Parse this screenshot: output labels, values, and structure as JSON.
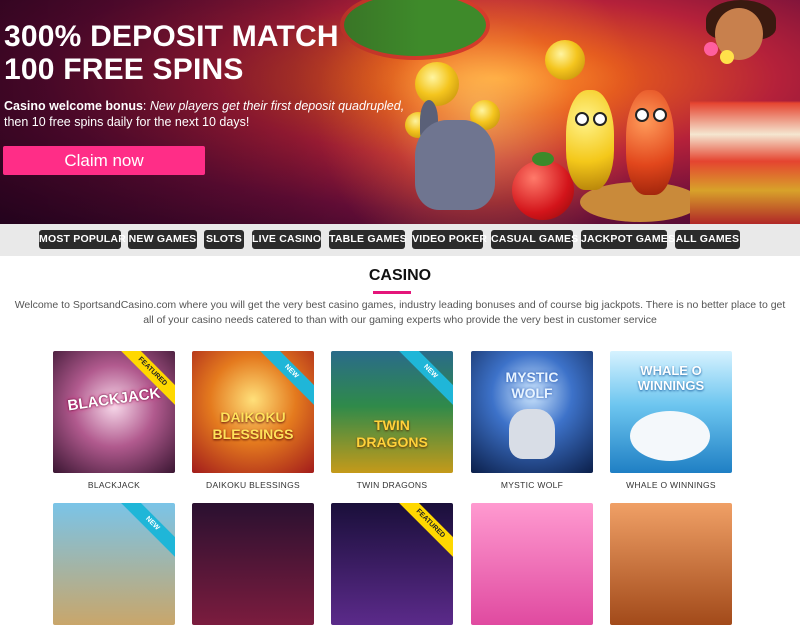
{
  "hero": {
    "headline_line1": "300% DEPOSIT MATCH",
    "headline_line2": "100 FREE SPINS",
    "desc_bold": "Casino welcome bonus",
    "desc_italic": "New players get their first deposit quadrupled,",
    "desc_rest": "then 10 free spins daily for the next 10 days!",
    "cta_label": "Claim now",
    "cta_color": "#ff2d87"
  },
  "nav": {
    "items": [
      {
        "label": "MOST POPULAR"
      },
      {
        "label": "NEW GAMES"
      },
      {
        "label": "SLOTS"
      },
      {
        "label": "LIVE CASINO"
      },
      {
        "label": "TABLE GAMES"
      },
      {
        "label": "VIDEO POKER"
      },
      {
        "label": "CASUAL GAMES"
      },
      {
        "label": "JACKPOT GAMES"
      },
      {
        "label": "ALL GAMES"
      }
    ]
  },
  "casino": {
    "title": "CASINO",
    "intro": "Welcome to SportsandCasino.com where you will get the very best casino games, industry leading bonuses and of course big jackpots. There is no better place to get all of your casino needs catered to than with our gaming experts who provide the very best in customer service",
    "accent_color": "#e4157a",
    "games": [
      {
        "name": "BLACKJACK",
        "art": "BLACKJACK",
        "badge": "FEATURED"
      },
      {
        "name": "DAIKOKU BLESSINGS",
        "art": "DAIKOKU BLESSINGS",
        "badge": "NEW"
      },
      {
        "name": "TWIN DRAGONS",
        "art": "TWIN DRAGONS",
        "badge": "NEW"
      },
      {
        "name": "MYSTIC WOLF",
        "art": "MYSTIC WOLF",
        "badge": ""
      },
      {
        "name": "WHALE O WINNINGS",
        "art": "WHALE O WINNINGS",
        "badge": ""
      }
    ],
    "games_row2": [
      {
        "badge": "NEW"
      },
      {
        "badge": ""
      },
      {
        "badge": "FEATURED"
      },
      {
        "badge": ""
      },
      {
        "badge": ""
      }
    ]
  }
}
